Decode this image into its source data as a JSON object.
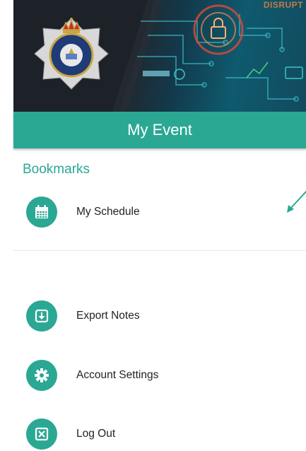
{
  "banner": {
    "tag_text": "DISRUPT"
  },
  "header": {
    "title": "My Event"
  },
  "section": {
    "title": "Bookmarks"
  },
  "menu": {
    "items": [
      {
        "label": "My Schedule",
        "icon": "calendar-icon"
      },
      {
        "label": "Export Notes",
        "icon": "export-icon"
      },
      {
        "label": "Account Settings",
        "icon": "gear-icon"
      },
      {
        "label": "Log Out",
        "icon": "logout-icon"
      }
    ]
  },
  "colors": {
    "accent": "#2aa894",
    "text": "#222222",
    "annotation": "#2aa894"
  }
}
